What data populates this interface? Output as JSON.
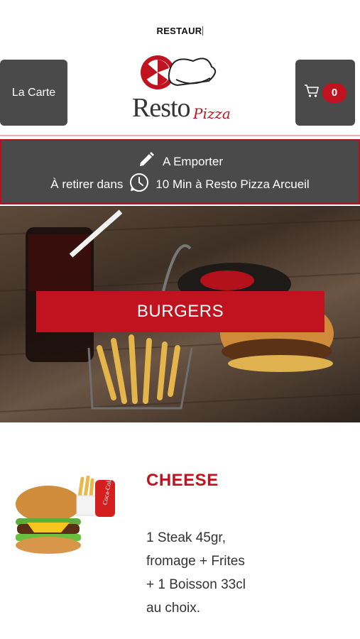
{
  "app": {
    "title": "RESTAUR",
    "brand_name": "Resto",
    "brand_name_accent": "Pizza"
  },
  "header": {
    "menu_button_label": "La Carte",
    "cart_count": "0",
    "cart_icon": "cart-icon"
  },
  "info": {
    "mode_label": "A Emporter",
    "pickup_prefix": "À retirer dans",
    "pickup_detail": "10 Min à Resto Pizza Arcueil",
    "icons": [
      "pencil-icon",
      "clock-icon"
    ]
  },
  "category": {
    "label": "BURGERS"
  },
  "product": {
    "name": "CHEESE",
    "description_lines": [
      "1 Steak 45gr,",
      "fromage  + Frites",
      "+ 1 Boisson 33cl",
      "au choix."
    ],
    "image_caption": "Coca-Cola"
  },
  "colors": {
    "accent": "#c1121f",
    "dark_panel": "#4a4a4a",
    "background": "#ffffff"
  }
}
